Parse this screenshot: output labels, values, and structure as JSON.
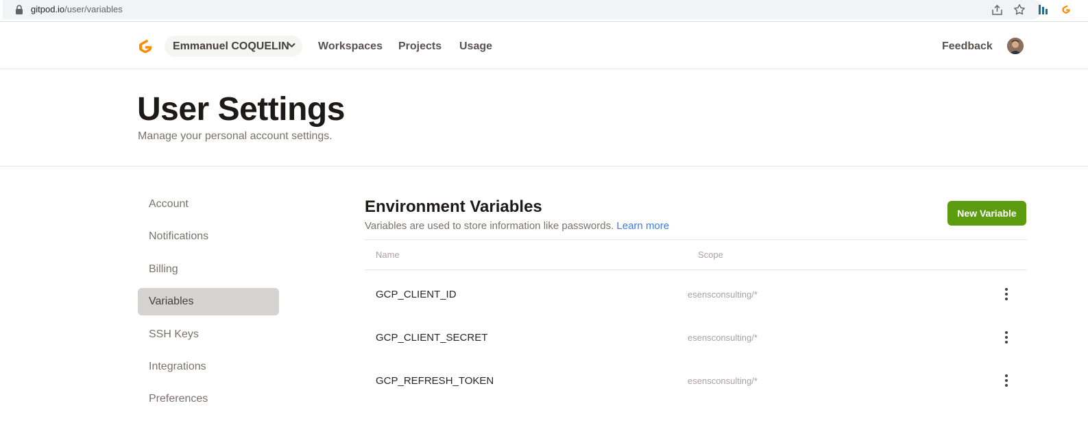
{
  "browser": {
    "url_host": "gitpod.io",
    "url_path": "/user/variables"
  },
  "header": {
    "org_name": "Emmanuel COQUELIN",
    "nav": [
      "Workspaces",
      "Projects",
      "Usage"
    ],
    "feedback": "Feedback"
  },
  "page": {
    "title": "User Settings",
    "subtitle": "Manage your personal account settings."
  },
  "sidebar": {
    "items": [
      {
        "label": "Account"
      },
      {
        "label": "Notifications"
      },
      {
        "label": "Billing"
      },
      {
        "label": "Variables"
      },
      {
        "label": "SSH Keys"
      },
      {
        "label": "Integrations"
      },
      {
        "label": "Preferences"
      }
    ],
    "active": "Variables"
  },
  "main": {
    "title": "Environment Variables",
    "description": "Variables are used to store information like passwords.",
    "learn_more": "Learn more",
    "new_button": "New Variable",
    "columns": [
      "Name",
      "Scope"
    ],
    "rows": [
      {
        "name": "GCP_CLIENT_ID",
        "scope": "esensconsulting/*"
      },
      {
        "name": "GCP_CLIENT_SECRET",
        "scope": "esensconsulting/*"
      },
      {
        "name": "GCP_REFRESH_TOKEN",
        "scope": "esensconsulting/*"
      }
    ]
  },
  "colors": {
    "accent_green": "#5d9b10",
    "link_blue": "#3b7be8",
    "logo_orange": "#ff8a00",
    "active_sidebar": "#d6d3d1"
  },
  "icons": [
    "lock-icon",
    "share-icon",
    "star-icon",
    "extension-icon",
    "gitpod-logo-icon",
    "chevron-down-icon",
    "more-vertical-icon"
  ]
}
